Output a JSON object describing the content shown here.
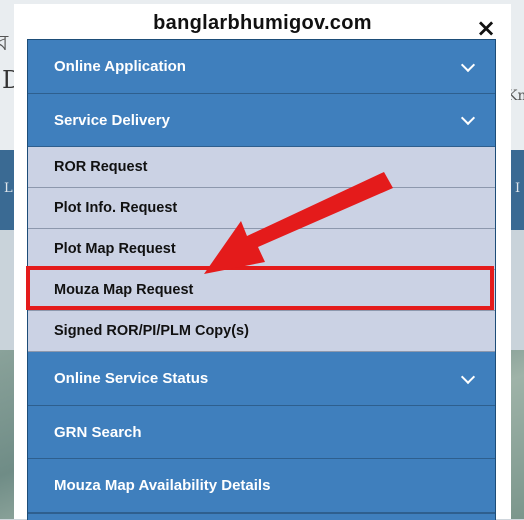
{
  "site_title": "banglarbhumigov.com",
  "close_label": "×",
  "menu": {
    "online_application": "Online Application",
    "service_delivery": "Service Delivery",
    "ror_request": "ROR Request",
    "plot_info_request": "Plot Info. Request",
    "plot_map_request": "Plot Map Request",
    "mouza_map_request": "Mouza Map Request",
    "signed_copy": "Signed ROR/PI/PLM Copy(s)",
    "online_service_status": "Online Service Status",
    "grn_search": "GRN Search",
    "mouza_map_availability": "Mouza Map Availability Details"
  },
  "colors": {
    "main_item": "#3f7fbd",
    "sub_item": "#cbd2e4",
    "highlight": "#e41b1b"
  },
  "icons": {
    "close": "close-icon",
    "expand": "chevron-down-icon",
    "pointer": "red-arrow-annotation"
  }
}
